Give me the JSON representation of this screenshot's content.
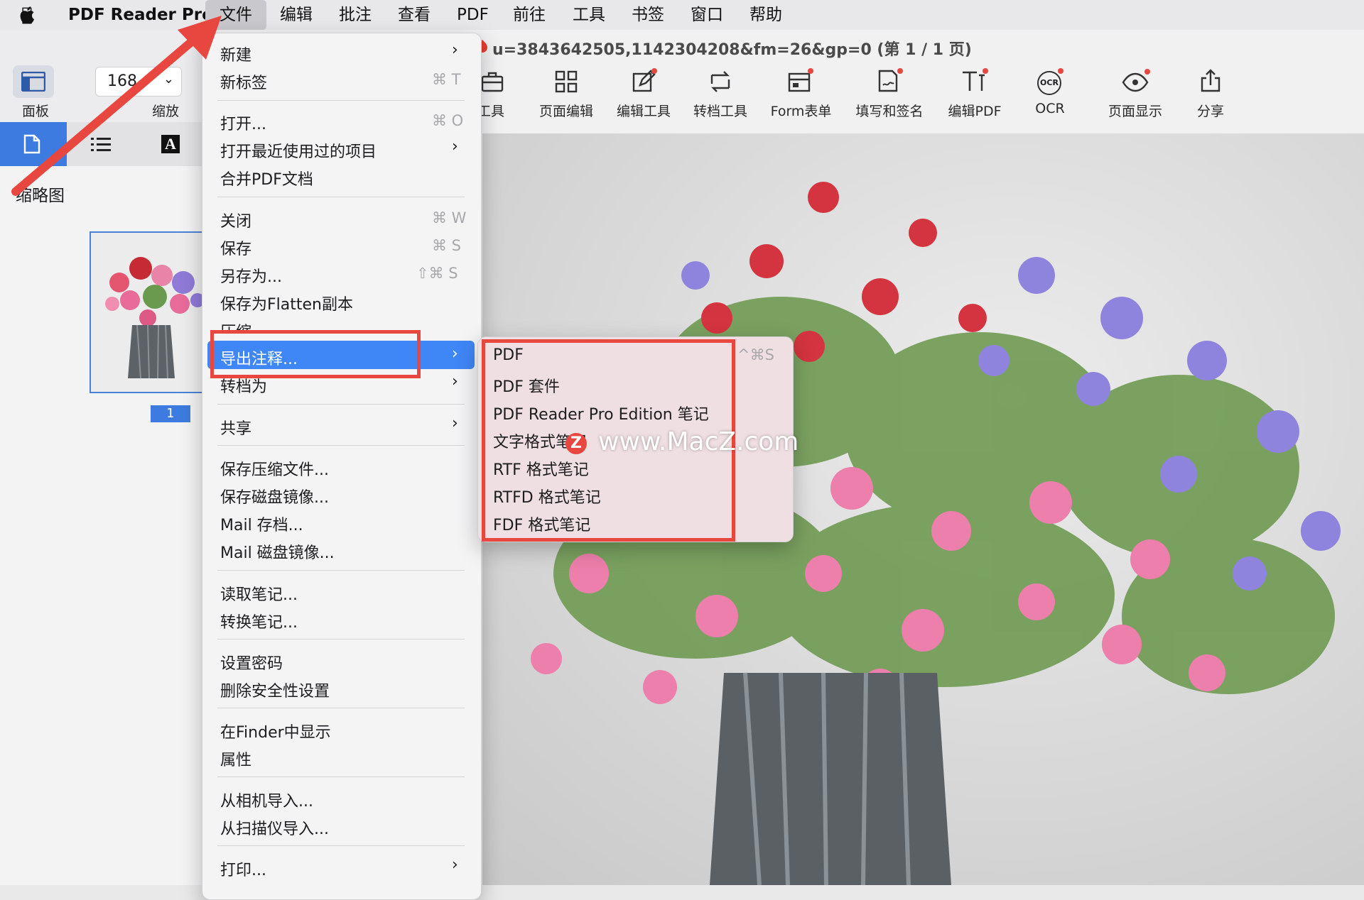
{
  "menubar": {
    "app_name": "PDF Reader Pro",
    "items": [
      "文件",
      "编辑",
      "批注",
      "查看",
      "PDF",
      "前往",
      "工具",
      "书签",
      "窗口",
      "帮助"
    ]
  },
  "window": {
    "title": "u=3843642505,1142304208&fm=26&gp=0 (第 1 / 1 页)"
  },
  "toolbar": {
    "panel_label": "面板",
    "zoom_value": "168",
    "zoom_label": "缩放",
    "items": [
      "工具",
      "页面编辑",
      "编辑工具",
      "转档工具",
      "Form表单",
      "填写和签名",
      "编辑PDF",
      "OCR",
      "页面显示",
      "分享"
    ],
    "ocr_icon_text": "OCR"
  },
  "sidebar": {
    "heading": "缩略图",
    "tab_font_glyph": "A",
    "page_number": "1"
  },
  "file_menu": {
    "items": [
      {
        "label": "新建",
        "shortcut": "",
        "submenu": true
      },
      {
        "label": "新标签",
        "shortcut": "⌘ T",
        "submenu": false
      },
      {
        "label": "打开...",
        "shortcut": "⌘ O",
        "submenu": false
      },
      {
        "label": "打开最近使用过的项目",
        "shortcut": "",
        "submenu": true
      },
      {
        "label": "合并PDF文档",
        "shortcut": "",
        "submenu": false
      },
      {
        "label": "关闭",
        "shortcut": "⌘ W",
        "submenu": false
      },
      {
        "label": "保存",
        "shortcut": "⌘ S",
        "submenu": false
      },
      {
        "label": "另存为...",
        "shortcut": "⇧⌘ S",
        "submenu": false
      },
      {
        "label": "保存为Flatten副本",
        "shortcut": "",
        "submenu": false
      },
      {
        "label": "压缩",
        "shortcut": "",
        "submenu": false
      },
      {
        "label": "导出注释...",
        "shortcut": "",
        "submenu": true
      },
      {
        "label": "转档为",
        "shortcut": "",
        "submenu": true
      },
      {
        "label": "共享",
        "shortcut": "",
        "submenu": true
      },
      {
        "label": "保存压缩文件...",
        "shortcut": "",
        "submenu": false
      },
      {
        "label": "保存磁盘镜像...",
        "shortcut": "",
        "submenu": false
      },
      {
        "label": "Mail 存档...",
        "shortcut": "",
        "submenu": false
      },
      {
        "label": "Mail 磁盘镜像...",
        "shortcut": "",
        "submenu": false
      },
      {
        "label": "读取笔记...",
        "shortcut": "",
        "submenu": false
      },
      {
        "label": "转换笔记...",
        "shortcut": "",
        "submenu": false
      },
      {
        "label": "设置密码",
        "shortcut": "",
        "submenu": false
      },
      {
        "label": "删除安全性设置",
        "shortcut": "",
        "submenu": false
      },
      {
        "label": "在Finder中显示",
        "shortcut": "",
        "submenu": false
      },
      {
        "label": "属性",
        "shortcut": "",
        "submenu": false
      },
      {
        "label": "从相机导入...",
        "shortcut": "",
        "submenu": false
      },
      {
        "label": "从扫描仪导入...",
        "shortcut": "",
        "submenu": false
      },
      {
        "label": "打印...",
        "shortcut": "",
        "submenu": true
      }
    ]
  },
  "export_submenu": {
    "items": [
      "PDF",
      "PDF 套件",
      "PDF Reader Pro Edition 笔记",
      "文字格式笔记",
      "RTF 格式笔记",
      "RTFD 格式笔记",
      "FDF 格式笔记"
    ],
    "first_shortcut": "^⌘S"
  },
  "watermark": {
    "text": "www.MacZ.com",
    "badge": "Z"
  },
  "colors": {
    "accent": "#3f86f6",
    "annotation_red": "#e8473f",
    "selected_tab": "#3d7be0"
  }
}
